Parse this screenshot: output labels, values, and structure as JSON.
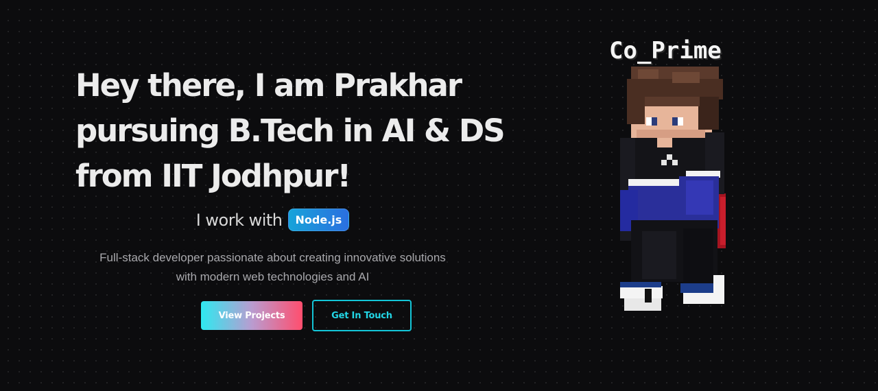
{
  "hero": {
    "headline_line1": "Hey there, I am Prakhar",
    "headline_line2": "pursuing B.Tech in AI & DS",
    "headline_line3": "from IIT Jodhpur!",
    "tech_prefix": "I work with",
    "tech_current": "Node.js",
    "description_line1": "Full-stack developer passionate about creating innovative solutions",
    "description_line2": "with modern web technologies and AI"
  },
  "buttons": {
    "view_projects": "View Projects",
    "get_in_touch": "Get In Touch"
  },
  "avatar": {
    "username": "Co_Prime",
    "icon": "minecraft-character-icon"
  },
  "colors": {
    "background": "#0c0c0e",
    "accent_cyan": "#14c6d8",
    "accent_pink": "#ff4e6e",
    "pill_blue": "#2b6fe0"
  }
}
